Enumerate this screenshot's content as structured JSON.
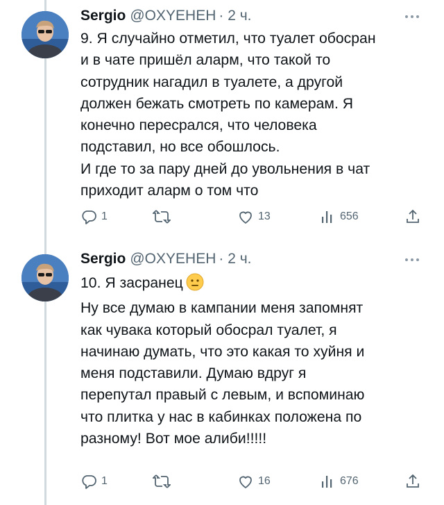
{
  "tweets": [
    {
      "author": {
        "name": "Sergio",
        "handle": "@OXYEHEH",
        "time": "· 2 ч."
      },
      "text": "9. Я случайно отметил, что туалет обосран\nи в чате пришёл аларм, что такой то\nсотрудник нагадил в туалете, а другой\nдолжен бежать смотреть по камерам. Я\nконечно пересрался, что человека\nподставил, но все обошлось.\nИ где то за пару дней до увольнения в чат\nприходит аларм о том что",
      "actions": {
        "replies": "1",
        "retweets": "",
        "likes": "13",
        "views": "656"
      }
    },
    {
      "author": {
        "name": "Sergio",
        "handle": "@OXYEHEH",
        "time": "· 2 ч."
      },
      "text_first_line": "10. Я засранец",
      "emoji": "neutral-face-emoji",
      "text": "\nНу все думаю в кампании меня запомнят\nкак чувака который обосрал туалет, я\nначинаю думать, что это какая то хуйня и\nменя подставили. Думаю вдруг я\nперепутал правый с левым, и вспоминаю\nчто плитка у нас в кабинках положена по\nразному! Вот мое алиби!!!!!",
      "actions": {
        "replies": "1",
        "retweets": "",
        "likes": "16",
        "views": "676"
      }
    }
  ],
  "icons": [
    "more-icon",
    "reply-icon",
    "retweet-icon",
    "like-icon",
    "views-icon",
    "share-icon"
  ],
  "colors": {
    "text": "#0f1419",
    "secondary": "#536471",
    "thread_line": "#cfd9de"
  }
}
